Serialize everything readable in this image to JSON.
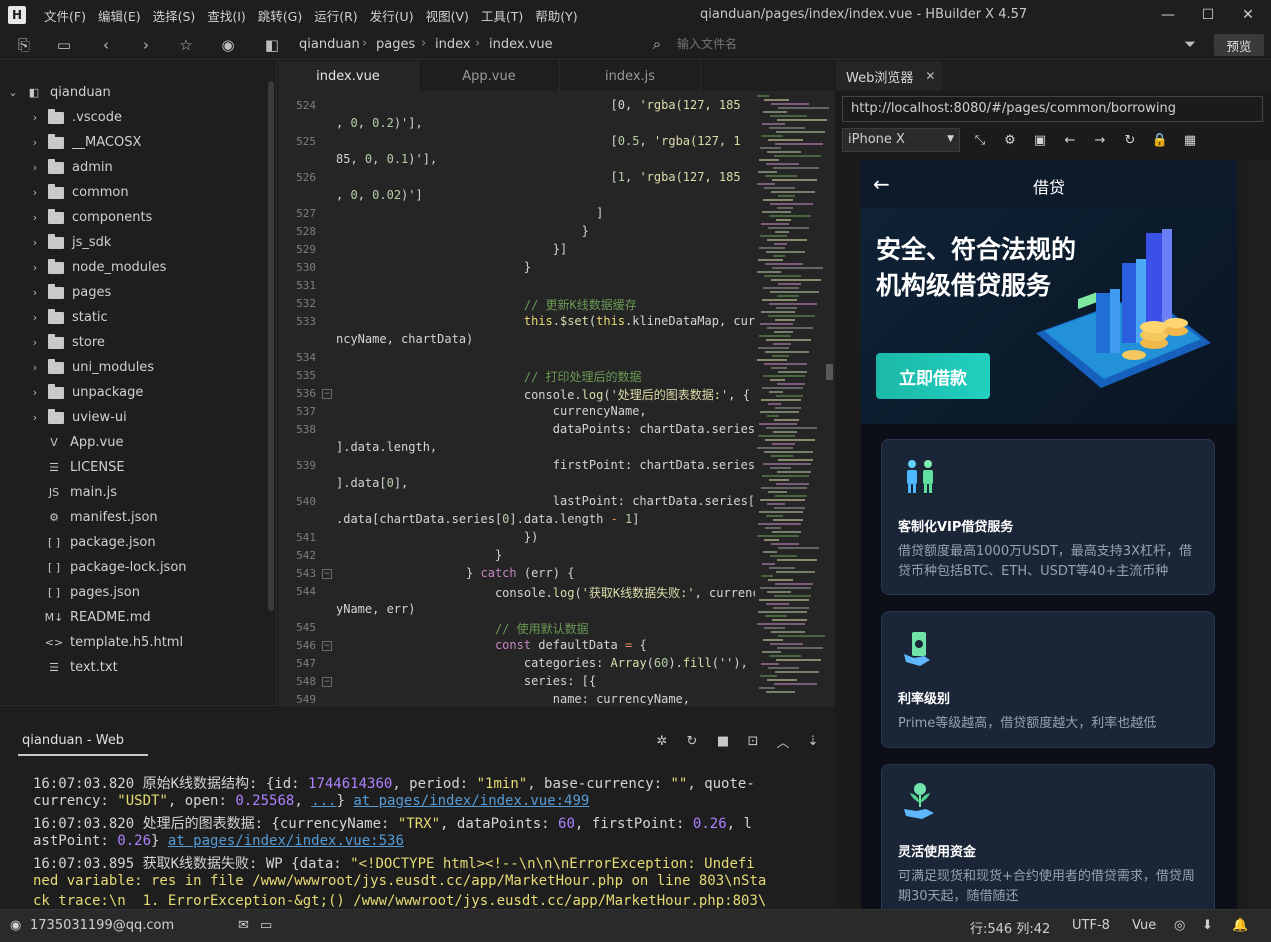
{
  "window": {
    "title": "qianduan/pages/index/index.vue - HBuilder X 4.57",
    "logo": "H",
    "menus": [
      "文件(F)",
      "编辑(E)",
      "选择(S)",
      "查找(I)",
      "跳转(G)",
      "运行(R)",
      "发行(U)",
      "视图(V)",
      "工具(T)",
      "帮助(Y)"
    ]
  },
  "toolbar": {
    "breadcrumb": [
      "qianduan",
      "pages",
      "index",
      "index.vue"
    ],
    "file_search_placeholder": "输入文件名",
    "preview_label": "预览"
  },
  "sidebar": {
    "root": "qianduan",
    "items": [
      {
        "label": ".vscode",
        "type": "folder"
      },
      {
        "label": "__MACOSX",
        "type": "folder"
      },
      {
        "label": "admin",
        "type": "folder"
      },
      {
        "label": "common",
        "type": "folder"
      },
      {
        "label": "components",
        "type": "folder"
      },
      {
        "label": "js_sdk",
        "type": "folder"
      },
      {
        "label": "node_modules",
        "type": "folder"
      },
      {
        "label": "pages",
        "type": "folder"
      },
      {
        "label": "static",
        "type": "folder"
      },
      {
        "label": "store",
        "type": "folder"
      },
      {
        "label": "uni_modules",
        "type": "folder"
      },
      {
        "label": "unpackage",
        "type": "folder"
      },
      {
        "label": "uview-ui",
        "type": "folder"
      },
      {
        "label": "App.vue",
        "type": "file",
        "icon": "V"
      },
      {
        "label": "LICENSE",
        "type": "file",
        "icon": "☰"
      },
      {
        "label": "main.js",
        "type": "file",
        "icon": "JS"
      },
      {
        "label": "manifest.json",
        "type": "file",
        "icon": "⚙"
      },
      {
        "label": "package.json",
        "type": "file",
        "icon": "[ ]"
      },
      {
        "label": "package-lock.json",
        "type": "file",
        "icon": "[ ]"
      },
      {
        "label": "pages.json",
        "type": "file",
        "icon": "[ ]"
      },
      {
        "label": "README.md",
        "type": "file",
        "icon": "M↓"
      },
      {
        "label": "template.h5.html",
        "type": "file",
        "icon": "<>"
      },
      {
        "label": "text.txt",
        "type": "file",
        "icon": "☰"
      }
    ]
  },
  "editor": {
    "tabs": [
      "index.vue",
      "App.vue",
      "index.js"
    ],
    "active_tab": "index.vue"
  },
  "console": {
    "tab": "qianduan - Web",
    "lines": [
      {
        "time": "16:07:03.820",
        "msg": "原始K线数据结构: {id: ",
        "n1": "1744614360",
        "p1": ", period: ",
        "s1": "\"1min\"",
        "p2": ", base-currency: ",
        "s2": "\"\"",
        "p3": ", quote-"
      },
      {
        "cont": "currency: ",
        "s1": "\"USDT\"",
        "p1": ", open: ",
        "n1": "0.25568",
        "p2": ", ",
        "link0": "...",
        "p3": "} ",
        "link": "at pages/index/index.vue:499"
      },
      {
        "time": "16:07:03.820",
        "msg": "处理后的图表数据: {currencyName: ",
        "s1": "\"TRX\"",
        "p1": ", dataPoints: ",
        "n1": "60",
        "p2": ", firstPoint: ",
        "n2": "0.26",
        "p3": ", l"
      },
      {
        "cont": "astPoint: ",
        "n1": "0.26",
        "p1": "} ",
        "link": "at pages/index/index.vue:536"
      },
      {
        "time": "16:07:03.895",
        "msg": "获取K线数据失败: WP {data: ",
        "s1": "\"<!DOCTYPE html><!--\\n\\n\\nErrorException: Undefi"
      },
      {
        "cont_str": "ned variable: res in file /www/wwwroot/jys.eusdt.cc/app/MarketHour.php on line 803\\nSta"
      },
      {
        "cont_str": "ck trace:\\n  1. ErrorException-&gt;() /www/wwwroot/jys.eusdt.cc/app/MarketHour.php:803\\"
      }
    ]
  },
  "statusbar": {
    "user": "1735031199@qq.com",
    "position": "行:546  列:42",
    "encoding": "UTF-8",
    "language": "Vue"
  },
  "browser": {
    "tab": "Web浏览器",
    "url": "http://localhost:8080/#/pages/common/borrowing",
    "device": "iPhone X"
  },
  "phone": {
    "title": "借贷",
    "banner_title": "安全、符合法规的机构级借贷服务",
    "cta": "立即借款",
    "cards": [
      {
        "title": "客制化VIP借贷服务",
        "desc": "借贷额度最高1000万USDT，最高支持3X杠杆，借贷币种包括BTC、ETH、USDT等40+主流币种"
      },
      {
        "title": "利率级别",
        "desc": "Prime等级越高，借贷额度越大，利率也越低"
      },
      {
        "title": "灵活使用资金",
        "desc": "可满足现货和现货+合约使用者的借贷需求，借贷周期30天起，随借随还"
      }
    ]
  },
  "colors": {
    "accent": "#22d0c0",
    "card_bg": "#1a2538",
    "link": "#569cd6"
  }
}
